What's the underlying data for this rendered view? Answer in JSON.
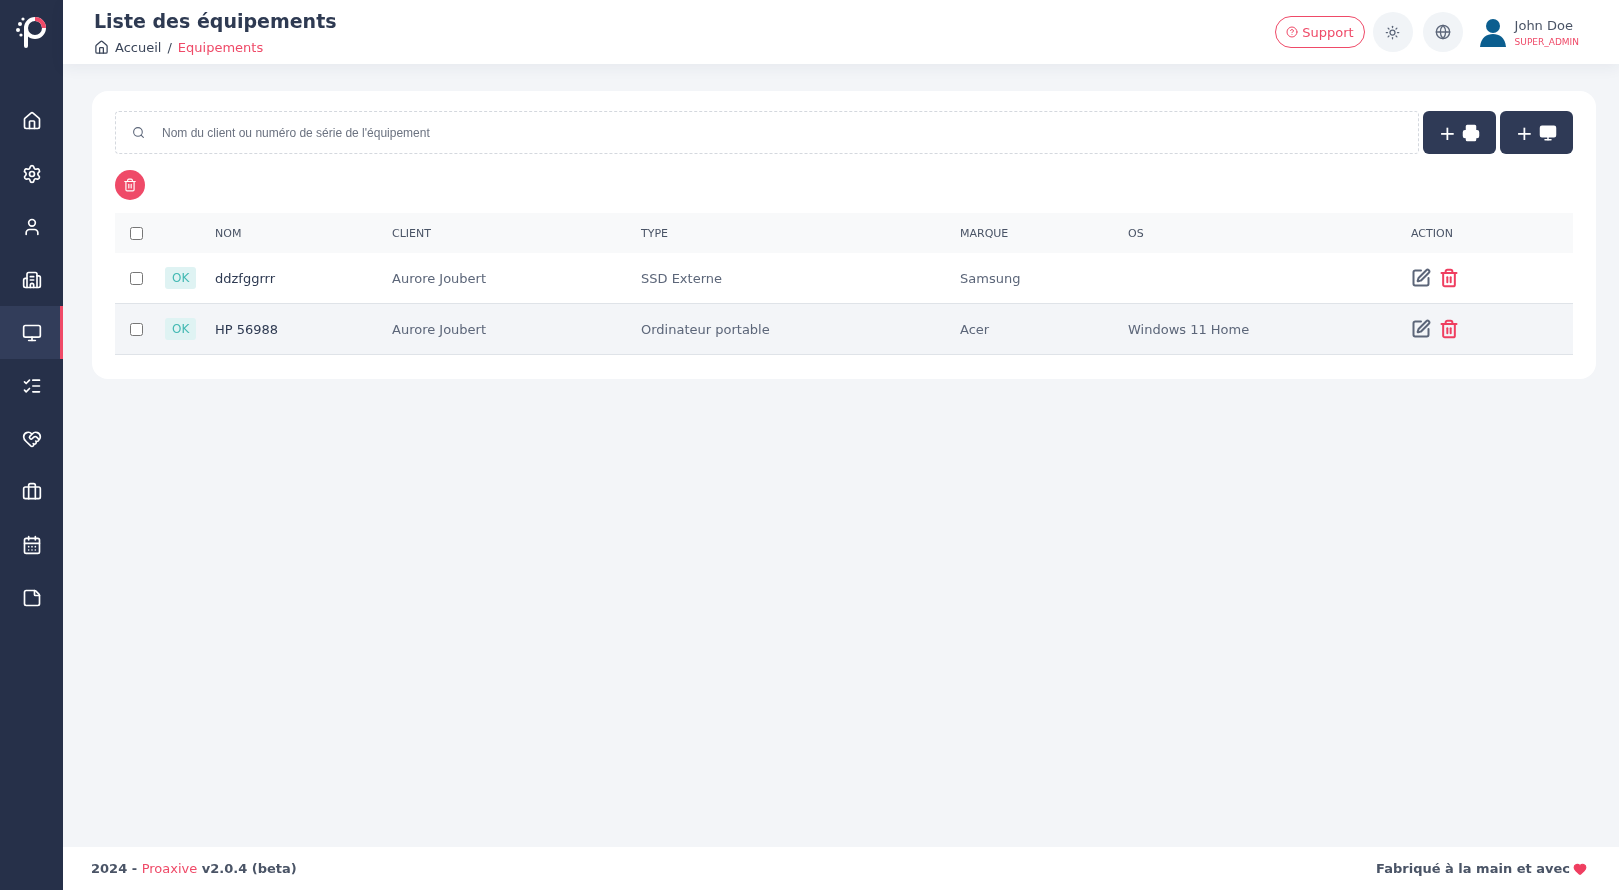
{
  "sidebar": {
    "items": [
      {
        "selected": false
      },
      {
        "selected": false
      },
      {
        "selected": false
      },
      {
        "selected": false
      },
      {
        "selected": true
      },
      {
        "selected": false
      },
      {
        "selected": false
      },
      {
        "selected": false
      },
      {
        "selected": false
      },
      {
        "selected": false
      }
    ]
  },
  "header": {
    "title": "Liste des équipements",
    "breadcrumb_separator": "/",
    "breadcrumb": [
      {
        "label": "Accueil",
        "current": false
      },
      {
        "label": "Equipements",
        "current": true
      }
    ],
    "support": "Support",
    "user": {
      "name": "John Doe",
      "role": "SUPER_ADMIN"
    }
  },
  "search": {
    "placeholder": "Nom du client ou numéro de série de l'équipement"
  },
  "add_buttons": [
    {
      "label": "+"
    },
    {
      "label": "+"
    }
  ],
  "table": {
    "select_all": false,
    "columns": [
      "NOM",
      "CLIENT",
      "TYPE",
      "MARQUE",
      "OS",
      "ACTION"
    ],
    "rows": [
      {
        "checked": false,
        "highlighted": false,
        "status": "OK",
        "name": "ddzfggrrr",
        "client": "Aurore Joubert",
        "type": "SSD Externe",
        "brand": "Samsung"
      },
      {
        "checked": false,
        "highlighted": true,
        "status": "OK",
        "name": "HP 56988",
        "client": "Aurore Joubert",
        "type": "Ordinateur portable",
        "brand": "Acer",
        "os": "Windows 11 Home"
      }
    ]
  },
  "footer": {
    "year": "2024 -",
    "brand": "Proaxive",
    "version": "v2.0.4 (beta)",
    "credit": "Fabriqué à la main et avec"
  }
}
